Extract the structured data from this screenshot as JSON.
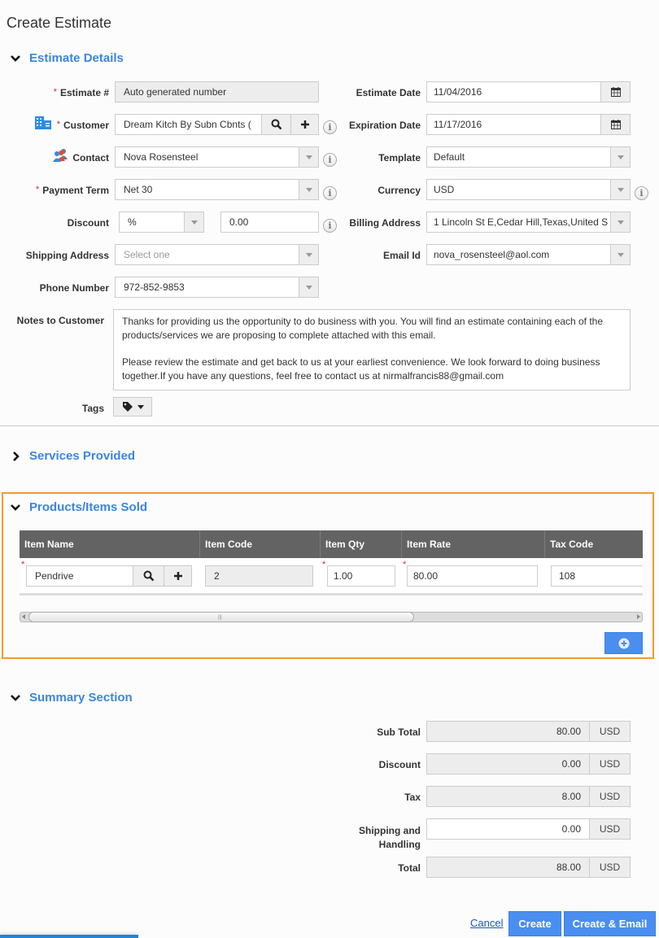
{
  "page": {
    "title": "Create Estimate"
  },
  "sections": {
    "estimate_details": "Estimate Details",
    "services_provided": "Services Provided",
    "products_items_sold": "Products/Items Sold",
    "summary_section": "Summary Section"
  },
  "form": {
    "estimate_no": {
      "label": "Estimate #",
      "value": "Auto generated number"
    },
    "customer": {
      "label": "Customer",
      "value": "Dream Kitch By Subn Cbnts ("
    },
    "contact": {
      "label": "Contact",
      "value": "Nova Rosensteel"
    },
    "payment_term": {
      "label": "Payment Term",
      "value": "Net 30"
    },
    "discount": {
      "label": "Discount",
      "type_value": "%",
      "amount": "0.00"
    },
    "shipping_address": {
      "label": "Shipping Address",
      "placeholder": "Select one"
    },
    "phone_number": {
      "label": "Phone Number",
      "value": "972-852-9853"
    },
    "estimate_date": {
      "label": "Estimate Date",
      "value": "11/04/2016"
    },
    "expiration_date": {
      "label": "Expiration Date",
      "value": "11/17/2016"
    },
    "template": {
      "label": "Template",
      "value": "Default"
    },
    "currency": {
      "label": "Currency",
      "value": "USD"
    },
    "billing_address": {
      "label": "Billing Address",
      "value": "1 Lincoln St E,Cedar Hill,Texas,United S"
    },
    "email_id": {
      "label": "Email Id",
      "value": "nova_rosensteel@aol.com"
    },
    "notes": {
      "label": "Notes to Customer",
      "paragraph1": "Thanks for providing us the opportunity to do business with you. You will find an estimate containing each of the products/services we are proposing to complete attached with this email.",
      "paragraph2": "Please review the estimate and get back to us at your earliest convenience. We look forward to doing business together.If you have any questions, feel free to contact us at nirmalfrancis88@gmail.com"
    },
    "tags": {
      "label": "Tags"
    }
  },
  "items_table": {
    "columns": [
      "Item Name",
      "Item Code",
      "Item Qty",
      "Item Rate",
      "Tax Code"
    ],
    "rows": [
      {
        "item_name": "Pendrive",
        "item_code": "2",
        "item_qty": "1.00",
        "item_rate": "80.00",
        "tax_code": "108"
      }
    ]
  },
  "summary": {
    "sub_total": {
      "label": "Sub Total",
      "value": "80.00",
      "currency": "USD"
    },
    "discount": {
      "label": "Discount",
      "value": "0.00",
      "currency": "USD"
    },
    "tax": {
      "label": "Tax",
      "value": "8.00",
      "currency": "USD"
    },
    "shipping": {
      "label": "Shipping and Handling",
      "value": "0.00",
      "currency": "USD"
    },
    "total": {
      "label": "Total",
      "value": "88.00",
      "currency": "USD"
    }
  },
  "actions": {
    "cancel": "Cancel",
    "create": "Create",
    "create_email": "Create & Email"
  },
  "icons": {
    "info": "i"
  },
  "colors": {
    "accent": "#3b86e0",
    "highlight_border": "#f59a2f",
    "button": "#4a8ef0",
    "required": "#d9262a"
  }
}
